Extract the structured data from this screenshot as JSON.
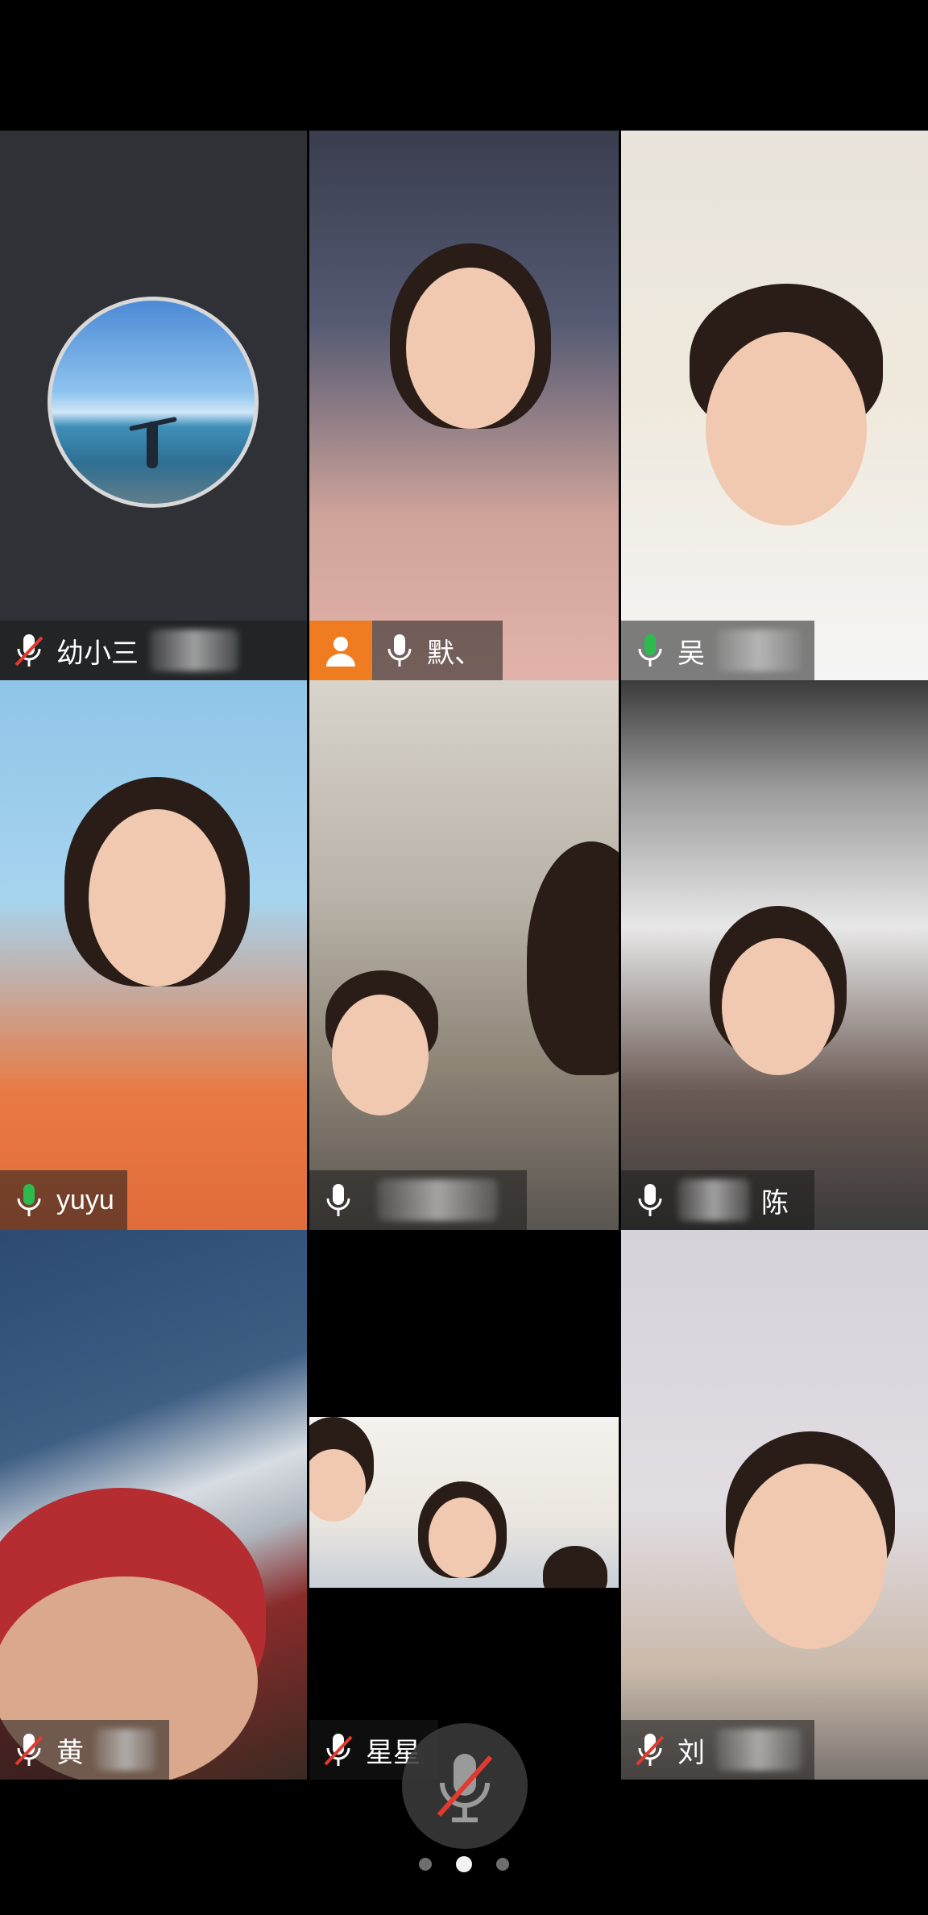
{
  "participants": [
    {
      "name": "幼小三",
      "mic": "muted",
      "video": "avatar"
    },
    {
      "name": "默、",
      "mic": "on",
      "video": "camera",
      "host": true,
      "speaking": true
    },
    {
      "name": "吴",
      "mic": "on-green",
      "video": "camera"
    },
    {
      "name": "yuyu",
      "mic": "on-green",
      "video": "camera"
    },
    {
      "name": "",
      "mic": "on",
      "video": "camera"
    },
    {
      "name": "陈",
      "mic": "on",
      "video": "camera"
    },
    {
      "name": "黄",
      "mic": "muted",
      "video": "camera"
    },
    {
      "name": "星星",
      "mic": "muted",
      "video": "camera-letterbox"
    },
    {
      "name": "刘",
      "mic": "muted",
      "video": "camera"
    }
  ],
  "controls": {
    "mic_state": "muted",
    "page_count": 3,
    "current_page": 2
  },
  "colors": {
    "active_border": "#2fbf5a",
    "host_badge": "#f07c22",
    "mic_green": "#2dbb4f",
    "mute_red": "#e23a2f"
  }
}
